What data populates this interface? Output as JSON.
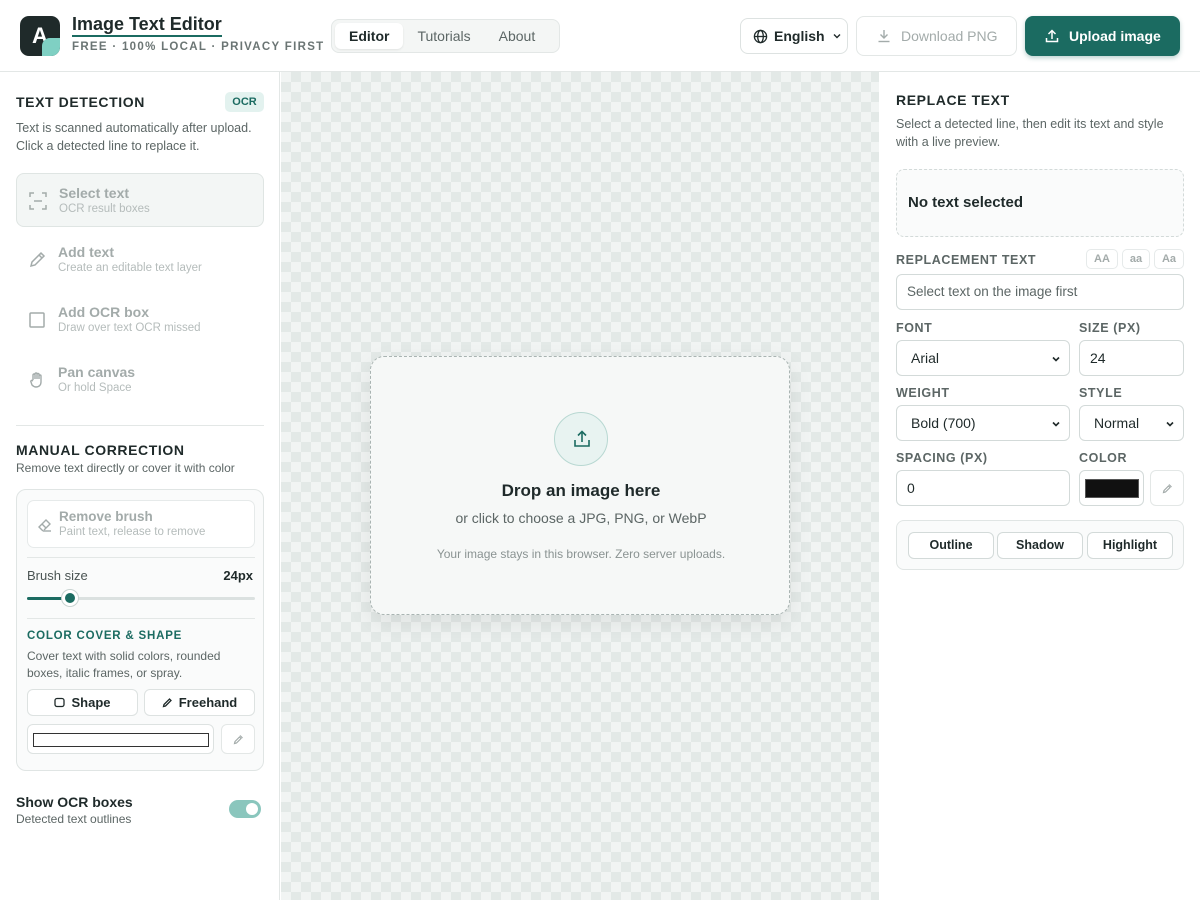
{
  "app": {
    "logo_letter": "A",
    "title": "Image Text Editor",
    "subtitle": "FREE · 100% LOCAL · PRIVACY FIRST",
    "accent_color": "#1b6b61"
  },
  "nav": {
    "tabs": [
      {
        "label": "Editor",
        "active": true
      },
      {
        "label": "Tutorials",
        "active": false
      },
      {
        "label": "About",
        "active": false
      }
    ]
  },
  "header_actions": {
    "language": "English",
    "download_label": "Download PNG",
    "upload_label": "Upload image"
  },
  "left_panel": {
    "text_detection": {
      "heading": "TEXT DETECTION",
      "badge": "OCR",
      "description": "Text is scanned automatically after upload. Click a detected line to replace it."
    },
    "tools": [
      {
        "name": "Select text",
        "sub": "OCR result boxes",
        "icon": "select-icon",
        "active": true
      },
      {
        "name": "Add text",
        "sub": "Create an editable text layer",
        "icon": "pencil-icon",
        "active": false
      },
      {
        "name": "Add OCR box",
        "sub": "Draw over text OCR missed",
        "icon": "square-icon",
        "active": false
      },
      {
        "name": "Pan canvas",
        "sub": "Or hold Space",
        "icon": "hand-icon",
        "active": false
      }
    ],
    "manual_correction": {
      "heading": "MANUAL CORRECTION",
      "description": "Remove text directly or cover it with color",
      "remove_brush": {
        "name": "Remove brush",
        "sub": "Paint text, release to remove"
      },
      "brush_size_label": "Brush size",
      "brush_size_value": "24px",
      "brush_size_fraction": 0.19,
      "color_cover_heading": "COLOR COVER & SHAPE",
      "color_cover_description": "Cover text with solid colors, rounded boxes, italic frames, or spray.",
      "shape_label": "Shape",
      "freehand_label": "Freehand",
      "cover_color": "#ffffff"
    },
    "show_ocr": {
      "label": "Show OCR boxes",
      "sub": "Detected text outlines",
      "enabled": true
    }
  },
  "canvas": {
    "drop_title": "Drop an image here",
    "drop_sub": "or click to choose a JPG, PNG, or WebP",
    "drop_note": "Your image stays in this browser. Zero server uploads."
  },
  "right_panel": {
    "heading": "REPLACE TEXT",
    "description": "Select a detected line, then edit its text and style with a live preview.",
    "no_selection": "No text selected",
    "replacement_label": "REPLACEMENT TEXT",
    "case_buttons": [
      "AA",
      "aa",
      "Aa"
    ],
    "replacement_placeholder": "Select text on the image first",
    "font_label": "FONT",
    "font_value": "Arial",
    "size_label": "SIZE (PX)",
    "size_value": "24",
    "weight_label": "WEIGHT",
    "weight_value": "Bold (700)",
    "style_label": "STYLE",
    "style_value": "Normal",
    "spacing_label": "SPACING (PX)",
    "spacing_value": "0",
    "color_label": "COLOR",
    "text_color": "#111111",
    "effects": [
      "Outline",
      "Shadow",
      "Highlight"
    ]
  }
}
